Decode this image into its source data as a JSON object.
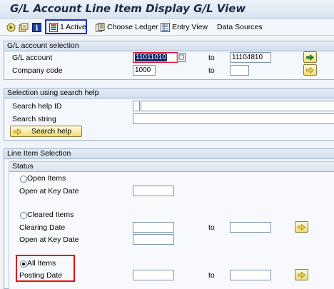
{
  "window": {
    "title": "G/L Account Line Item Display G/L View"
  },
  "toolbar": {
    "active_label": "1  Active",
    "choose_ledger_label": "Choose Ledger",
    "entry_view_label": "Entry View",
    "data_sources_label": "Data Sources"
  },
  "gl_selection": {
    "header": "G/L account selection",
    "account_label": "G/L account",
    "account_from": "11011010",
    "account_to": "11104810",
    "company_label": "Company code",
    "company_from": "1000",
    "company_to": "",
    "to_label": "to"
  },
  "search_help": {
    "header": "Selection using search help",
    "id_label": "Search help ID",
    "id_value": "",
    "string_label": "Search string",
    "string_value": "",
    "button_label": "Search help"
  },
  "line_item": {
    "header": "Line Item Selection",
    "status_header": "Status",
    "open_items_label": "Open Items",
    "open_at_key_date_label": "Open at Key Date",
    "open_at_key_date_value": "",
    "cleared_items_label": "Cleared Items",
    "clearing_date_label": "Clearing Date",
    "clearing_date_from": "",
    "clearing_date_to": "",
    "cleared_open_key_date_label": "Open at Key Date",
    "cleared_open_key_date_value": "",
    "all_items_label": "All Items",
    "posting_date_label": "Posting Date",
    "posting_date_from": "",
    "posting_date_to": "",
    "to_label": "to",
    "selected_status": "All Items"
  },
  "colors": {
    "highlight_blue": "#1c2fd0",
    "highlight_red": "#e01010",
    "title_text": "#1a2a48"
  }
}
